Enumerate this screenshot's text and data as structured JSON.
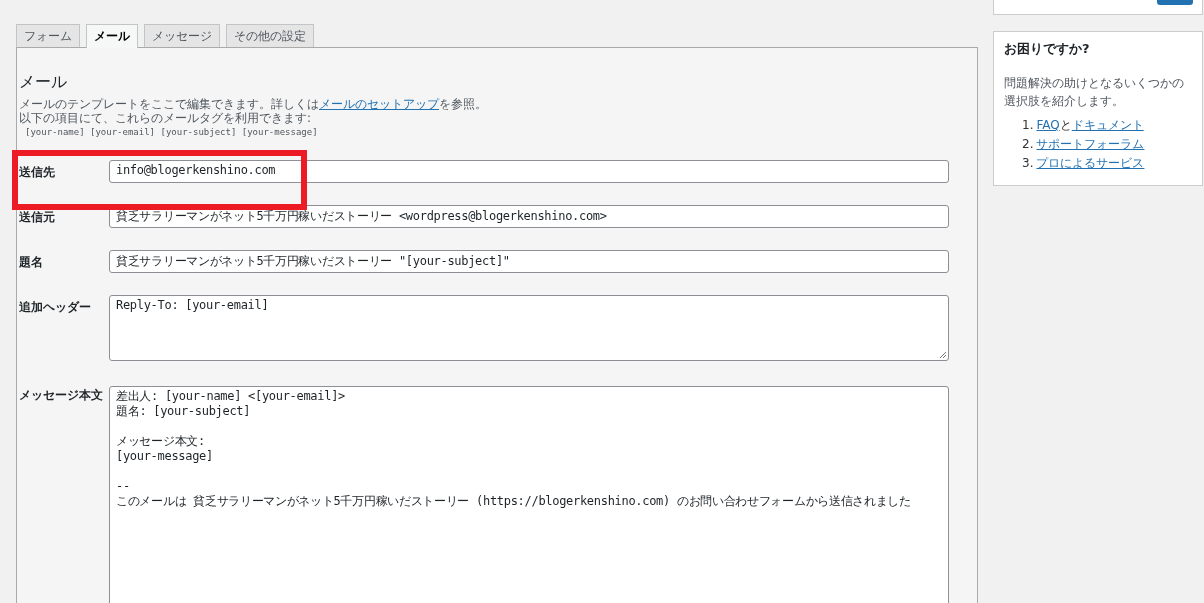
{
  "tabs": [
    {
      "label": "フォーム",
      "selected": false
    },
    {
      "label": "メール",
      "selected": true
    },
    {
      "label": "メッセージ",
      "selected": false
    },
    {
      "label": "その他の設定",
      "selected": false
    }
  ],
  "mail": {
    "heading": "メール",
    "intro": {
      "before": "メールのテンプレートをここで編集できます。詳しくは",
      "link": "メールのセットアップ",
      "after": "を参照。"
    },
    "tags_note": "以下の項目にて、これらのメールタグを利用できます:",
    "tags": "[your-name] [your-email] [your-subject] [your-message]",
    "fields": [
      {
        "kind": "input",
        "label": "送信先",
        "value": "info@blogerkenshino.com"
      },
      {
        "kind": "input",
        "label": "送信元",
        "value": "貧乏サラリーマンがネット5千万円稼いだストーリー <wordpress@blogerkenshino.com>"
      },
      {
        "kind": "input",
        "label": "題名",
        "value": "貧乏サラリーマンがネット5千万円稼いだストーリー \"[your-subject]\""
      },
      {
        "kind": "textarea",
        "label": "追加ヘッダー",
        "lines": [
          "Reply-To: [your-email]"
        ]
      },
      {
        "kind": "body",
        "label": "メッセージ本文",
        "paragraphs": [
          [
            "差出人: [your-name] <[your-email]>",
            "題名: [your-subject]"
          ],
          [
            "メッセージ本文:",
            "[your-message]"
          ],
          [
            "--",
            "このメールは 貧乏サラリーマンがネット5千万円稼いだストーリー (https://blogerkenshino.com) のお問い合わせフォームから送信されました"
          ]
        ]
      }
    ]
  },
  "help": {
    "title": "お困りですか?",
    "text": "問題解決の助けとなるいくつかの選択肢を紹介します。",
    "items": [
      {
        "number": "1.",
        "links": [
          "FAQ",
          "ドキュメント"
        ],
        "joiner": "と"
      },
      {
        "number": "2.",
        "links": [
          "サポートフォーラム"
        ]
      },
      {
        "number": "3.",
        "links": [
          "プロによるサービス"
        ]
      }
    ]
  }
}
